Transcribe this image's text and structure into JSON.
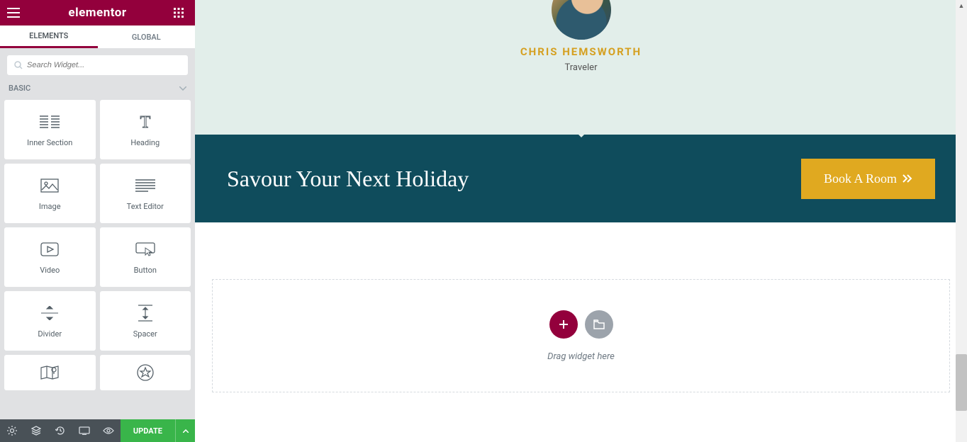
{
  "topbar": {
    "logo": "elementor"
  },
  "tabs": {
    "elements": "ELEMENTS",
    "global": "GLOBAL"
  },
  "search": {
    "placeholder": "Search Widget..."
  },
  "category": {
    "label": "BASIC"
  },
  "widgets": [
    {
      "label": "Inner Section"
    },
    {
      "label": "Heading"
    },
    {
      "label": "Image"
    },
    {
      "label": "Text Editor"
    },
    {
      "label": "Video"
    },
    {
      "label": "Button"
    },
    {
      "label": "Divider"
    },
    {
      "label": "Spacer"
    },
    {
      "label": ""
    },
    {
      "label": ""
    }
  ],
  "footer": {
    "update": "UPDATE"
  },
  "preview": {
    "testimonial": {
      "name": "CHRIS HEMSWORTH",
      "role": "Traveler"
    },
    "cta": {
      "heading": "Savour Your Next Holiday",
      "button": "Book A Room"
    },
    "drop": {
      "text": "Drag widget here"
    }
  }
}
